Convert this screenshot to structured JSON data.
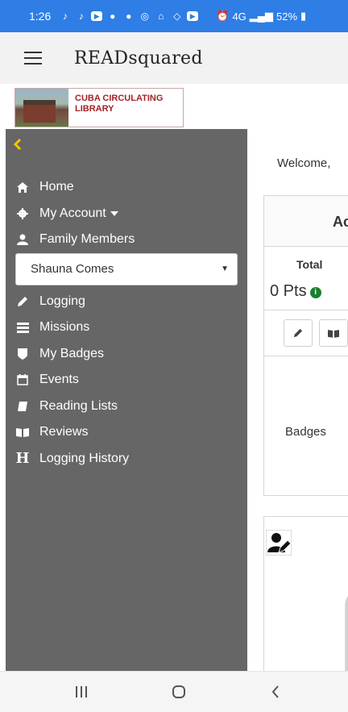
{
  "status_bar": {
    "time": "1:26",
    "network": "4G",
    "battery": "52%",
    "bg_color": "#2e7ee6"
  },
  "app_bar": {
    "title": "READsquared"
  },
  "library_logo": {
    "line1": "CUBA CIRCULATING",
    "line2": "LIBRARY"
  },
  "sidebar": {
    "bg_color": "#666666",
    "items": [
      {
        "label": "Home",
        "icon": "home-icon"
      },
      {
        "label": "My Account",
        "icon": "gear-icon"
      },
      {
        "label": "Family Members",
        "icon": "user-icon"
      },
      {
        "label": "Logging",
        "icon": "pencil-icon"
      },
      {
        "label": "Missions",
        "icon": "missions-icon"
      },
      {
        "label": "My Badges",
        "icon": "badge-icon"
      },
      {
        "label": "Events",
        "icon": "calendar-icon"
      },
      {
        "label": "Reading Lists",
        "icon": "book-icon"
      },
      {
        "label": "Reviews",
        "icon": "open-book-icon"
      },
      {
        "label": "Logging History",
        "icon": "h-icon"
      }
    ],
    "family_select": {
      "value": "Shauna Comes"
    }
  },
  "main": {
    "welcome": "Welcome,",
    "card": {
      "header": "Ac",
      "total_label": "Total",
      "points": "0 Pts",
      "badges_text": "Badges"
    }
  }
}
